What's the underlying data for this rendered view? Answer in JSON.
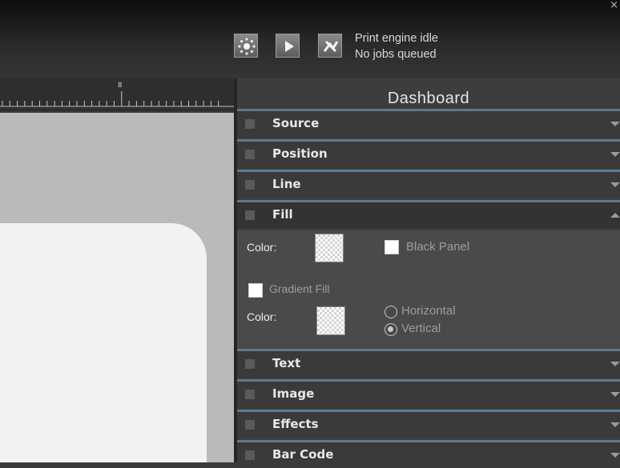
{
  "window": {
    "close_glyph": "×"
  },
  "toolbar": {
    "buttons": [
      {
        "name": "settings-button",
        "icon": "sun-gear-icon"
      },
      {
        "name": "play-button",
        "icon": "play-icon"
      },
      {
        "name": "cancel-button",
        "icon": "cancel-x-icon"
      }
    ],
    "status_line1": "Print engine idle",
    "status_line2": "No jobs queued"
  },
  "ruler": {
    "mark_label": "8"
  },
  "dashboard": {
    "title": "Dashboard",
    "sections": {
      "source": "Source",
      "position": "Position",
      "line": "Line",
      "fill": "Fill",
      "text": "Text",
      "image": "Image",
      "effects": "Effects",
      "barcode": "Bar Code"
    },
    "fill": {
      "color_label_1": "Color:",
      "black_panel_label": "Black Panel",
      "gradient_fill_label": "Gradient Fill",
      "color_label_2": "Color:",
      "horizontal_label": "Horizontal",
      "vertical_label": "Vertical",
      "orientation_selected": "Vertical"
    }
  },
  "colors": {
    "section_border": "#5c7a90",
    "panel_bg": "#3d3d3d",
    "fill_body_bg": "#4a4a4a"
  }
}
